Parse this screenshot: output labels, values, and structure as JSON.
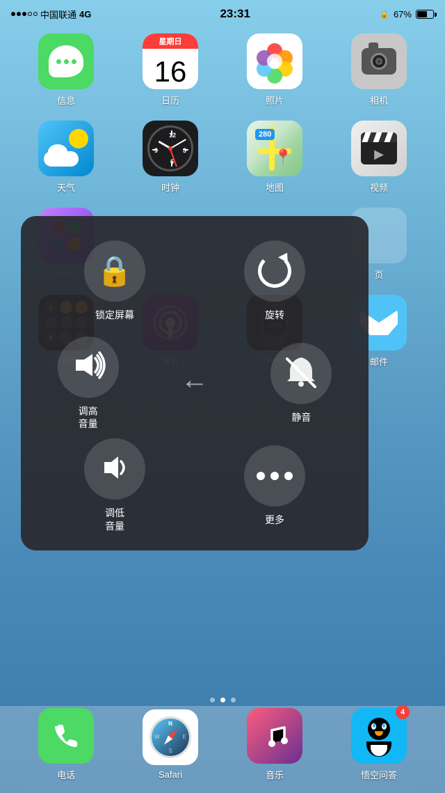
{
  "statusBar": {
    "dots": [
      "filled",
      "filled",
      "filled",
      "empty",
      "empty"
    ],
    "carrier": "中国联通",
    "network": "4G",
    "time": "23:31",
    "lock": "🔒",
    "batteryPct": "67%"
  },
  "apps": {
    "row1": [
      {
        "id": "messages",
        "label": "信息",
        "icon": "messages"
      },
      {
        "id": "calendar",
        "label": "日历",
        "icon": "calendar",
        "day": "16",
        "weekday": "星期日"
      },
      {
        "id": "photos",
        "label": "照片",
        "icon": "photos"
      },
      {
        "id": "camera",
        "label": "相机",
        "icon": "camera"
      }
    ],
    "row2": [
      {
        "id": "weather",
        "label": "天气",
        "icon": "weather"
      },
      {
        "id": "clock",
        "label": "时钟",
        "icon": "clock"
      },
      {
        "id": "maps",
        "label": "地图",
        "icon": "maps"
      },
      {
        "id": "videos",
        "label": "视频",
        "icon": "videos"
      }
    ],
    "row3": [
      {
        "id": "gamecenter",
        "label": "Gam...",
        "icon": "gamecenter"
      },
      {
        "id": "placeholder1",
        "label": "",
        "icon": "empty"
      },
      {
        "id": "placeholder2",
        "label": "",
        "icon": "empty"
      },
      {
        "id": "placeholder3",
        "label": "页",
        "icon": "empty"
      }
    ],
    "row4": [
      {
        "id": "calculator",
        "label": "计算器",
        "icon": "calculator"
      },
      {
        "id": "podcasts",
        "label": "播客",
        "icon": "podcasts"
      },
      {
        "id": "watch",
        "label": "Watch",
        "icon": "watch"
      },
      {
        "id": "mail",
        "label": "邮件",
        "icon": "mail"
      }
    ]
  },
  "dock": [
    {
      "id": "phone",
      "label": "电话",
      "icon": "phone"
    },
    {
      "id": "safari",
      "label": "Safari",
      "icon": "safari"
    },
    {
      "id": "music",
      "label": "音乐",
      "icon": "music"
    },
    {
      "id": "qq",
      "label": "悟空问答",
      "icon": "qq",
      "badge": "4"
    }
  ],
  "overlay": {
    "row1": [
      {
        "id": "lock-screen",
        "label": "锁定屏幕",
        "icon": "lock"
      },
      {
        "id": "rotate",
        "label": "旋转",
        "icon": "rotate"
      }
    ],
    "row2": [
      {
        "id": "volume-up",
        "label": "调高\n音量",
        "icon": "vol-up"
      },
      {
        "id": "back",
        "label": "",
        "icon": "arrow-back"
      },
      {
        "id": "mute",
        "label": "静音",
        "icon": "mute"
      }
    ],
    "row3": [
      {
        "id": "volume-down",
        "label": "调低\n音量",
        "icon": "vol-down"
      },
      {
        "id": "more",
        "label": "更多",
        "icon": "more"
      }
    ]
  },
  "pageDots": [
    0,
    1,
    2
  ],
  "activePageDot": 1
}
